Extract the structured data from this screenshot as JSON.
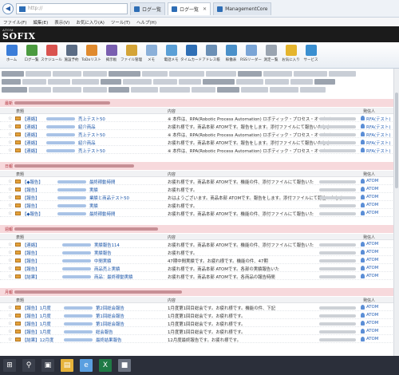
{
  "browser": {
    "tab1_label": "ログ一覧",
    "tab2_label": "ログ一覧",
    "tab3_label": "ManagementCore",
    "address_placeholder": "http://"
  },
  "menu": [
    "ファイル(F)",
    "編集(E)",
    "表示(V)",
    "お気に入り(A)",
    "ツール(T)",
    "ヘルプ(H)"
  ],
  "logo": {
    "sub": "ATOM",
    "main": "SOFIX"
  },
  "toolbar": [
    {
      "label": "ホーム",
      "icon": "home-icon",
      "color": "#3b7dd8"
    },
    {
      "label": "ログ一覧",
      "icon": "list-icon",
      "color": "#4b9a3f"
    },
    {
      "label": "スケジュール",
      "icon": "calendar-icon",
      "color": "#d9534f"
    },
    {
      "label": "施設予約",
      "icon": "building-icon",
      "color": "#5b6c84"
    },
    {
      "label": "ToDoリスト",
      "icon": "todo-icon",
      "color": "#e08a2e"
    },
    {
      "label": "掲示板",
      "icon": "board-icon",
      "color": "#7a5fb0"
    },
    {
      "label": "ファイル管理",
      "icon": "folder-icon",
      "color": "#d4a437"
    },
    {
      "label": "メモ",
      "icon": "memo-icon",
      "color": "#8bb0d9"
    },
    {
      "label": "電話メモ",
      "icon": "phone-icon",
      "color": "#5a9fd6"
    },
    {
      "label": "タイムカード",
      "icon": "timecard-icon",
      "color": "#2f6fb5"
    },
    {
      "label": "アドレス帳",
      "icon": "address-icon",
      "color": "#6a8fb5"
    },
    {
      "label": "稼働表",
      "icon": "sheet-icon",
      "color": "#4a90c9"
    },
    {
      "label": "RSSリーダー",
      "icon": "rss-icon",
      "color": "#7aa5d6"
    },
    {
      "label": "測定一覧",
      "icon": "gauge-icon",
      "color": "#9aa4b0"
    },
    {
      "label": "お気に入り",
      "icon": "star-icon",
      "color": "#e5b52e"
    },
    {
      "label": "サービス",
      "icon": "globe-icon",
      "color": "#3a8fd0"
    }
  ],
  "column_headers": {
    "title": "表題",
    "content": "内容",
    "sender": "発信人"
  },
  "sections": [
    {
      "header": "最新",
      "rows": [
        {
          "title": "【連絡】",
          "title_tail": "売上テスト50",
          "content": "※ 本件は、RPA(Robotic Process Automation) ロボティック・プロセス・オートメー",
          "sender": "RFA(テスト)"
        },
        {
          "title": "【連絡】",
          "title_tail": "紹介商品",
          "content": "お疲れ様です。商品本部 ATOMです。報告をします。添付ファイルにて報告いたしま",
          "sender": "RFA(テスト)"
        },
        {
          "title": "【連絡】",
          "title_tail": "売上テスト50",
          "content": "※ 本件は、RPA(Robotic Process Automation) ロボティック・プロセス・オートメー",
          "sender": "RFA(テスト)"
        },
        {
          "title": "【連絡】",
          "title_tail": "紹介商品",
          "content": "お疲れ様です。商品本部 ATOMです。報告をします。添付ファイルにて報告いたしま",
          "sender": "RFA(テスト)"
        },
        {
          "title": "【連絡】",
          "title_tail": "売上テスト50",
          "content": "※ 本件は、RPA(Robotic Process Automation) ロボティック・プロセス・オートメー",
          "sender": "RFA(テスト)"
        }
      ]
    },
    {
      "header": "日報",
      "rows": [
        {
          "title": "【◆報告】",
          "title_tail": "最終稼動時間",
          "content": "お疲れ様です。商品本部 ATOMです。機能の件、添付ファイルにて報告いた",
          "sender": "ATOM"
        },
        {
          "title": "【報告】",
          "title_tail": "実績",
          "content": "お疲れ様です。",
          "sender": "ATOM"
        },
        {
          "title": "【報告】",
          "title_tail": "業績と商品テスト50",
          "content": "おはようございます。商品本部 ATOMです。報告をします。添付ファイルにて報告いたしま",
          "sender": "ATOM"
        },
        {
          "title": "【報告】",
          "title_tail": "実績",
          "content": "お疲れ様です。",
          "sender": "ATOM"
        },
        {
          "title": "【◆報告】",
          "title_tail": "最終稼動時間",
          "content": "お疲れ様です。商品本部 ATOMです。機能の件、添付ファイルにて報告いた",
          "sender": "ATOM"
        }
      ]
    },
    {
      "header": "週報",
      "rows": [
        {
          "title": "【連絡】",
          "title_tail": "実績報告114",
          "content": "お疲れ様です。商品本部 ATOMです。機能の件、添付ファイルにて報告いた",
          "sender": "ATOM"
        },
        {
          "title": "【報告】",
          "title_tail": "実績報告",
          "content": "お疲れ様です。",
          "sender": "ATOM"
        },
        {
          "title": "【報告】",
          "title_tail": "中間実績",
          "content": "47期中間実績です。お疲れ様です。機能の件、47期",
          "sender": "ATOM"
        },
        {
          "title": "【報告】",
          "title_tail": "商品売上実績",
          "content": "お疲れ様です。商品本部 ATOMです。各部の実績報告いた",
          "sender": "ATOM"
        },
        {
          "title": "【結果】",
          "title_tail": "商品：最終稼動実績",
          "content": "お疲れ様です。商品本部 ATOMです。各商品の報告時間",
          "sender": "ATOM"
        }
      ]
    },
    {
      "header": "月報",
      "rows": [
        {
          "title": "【報告】1月度",
          "title_tail": "第2回総会報告",
          "content": "1月度第1回目総会です。お疲れ様です。機能の件、下記",
          "sender": "ATOM"
        },
        {
          "title": "【報告】1月度",
          "title_tail": "第1回総会報告",
          "content": "1月度第1回目総会です。お疲れ様です。",
          "sender": "ATOM"
        },
        {
          "title": "【報告】1月度",
          "title_tail": "第1回総会報告",
          "content": "1月度第1回目総会です。お疲れ様です。",
          "sender": "ATOM"
        },
        {
          "title": "【報告】1月度",
          "title_tail": "総会報告",
          "content": "1月度第1回目総会です。お疲れ様です。",
          "sender": "ATOM"
        },
        {
          "title": "【結果】12月度",
          "title_tail": "最終結果報告",
          "content": "12月度最終報告です。お疲れ様です。",
          "sender": "ATOM"
        }
      ]
    }
  ],
  "taskbar": [
    {
      "icon": "windows-start-icon",
      "color": "#3a3f4b"
    },
    {
      "icon": "search-icon",
      "color": "#3a3f4b"
    },
    {
      "icon": "task-view-icon",
      "color": "#3a3f4b"
    },
    {
      "icon": "file-explorer-icon",
      "color": "#e6b33a"
    },
    {
      "icon": "internet-explorer-icon",
      "color": "#5a9fe0"
    },
    {
      "icon": "excel-icon",
      "color": "#1f7a45"
    },
    {
      "icon": "app-icon",
      "color": "#6b7280"
    }
  ]
}
